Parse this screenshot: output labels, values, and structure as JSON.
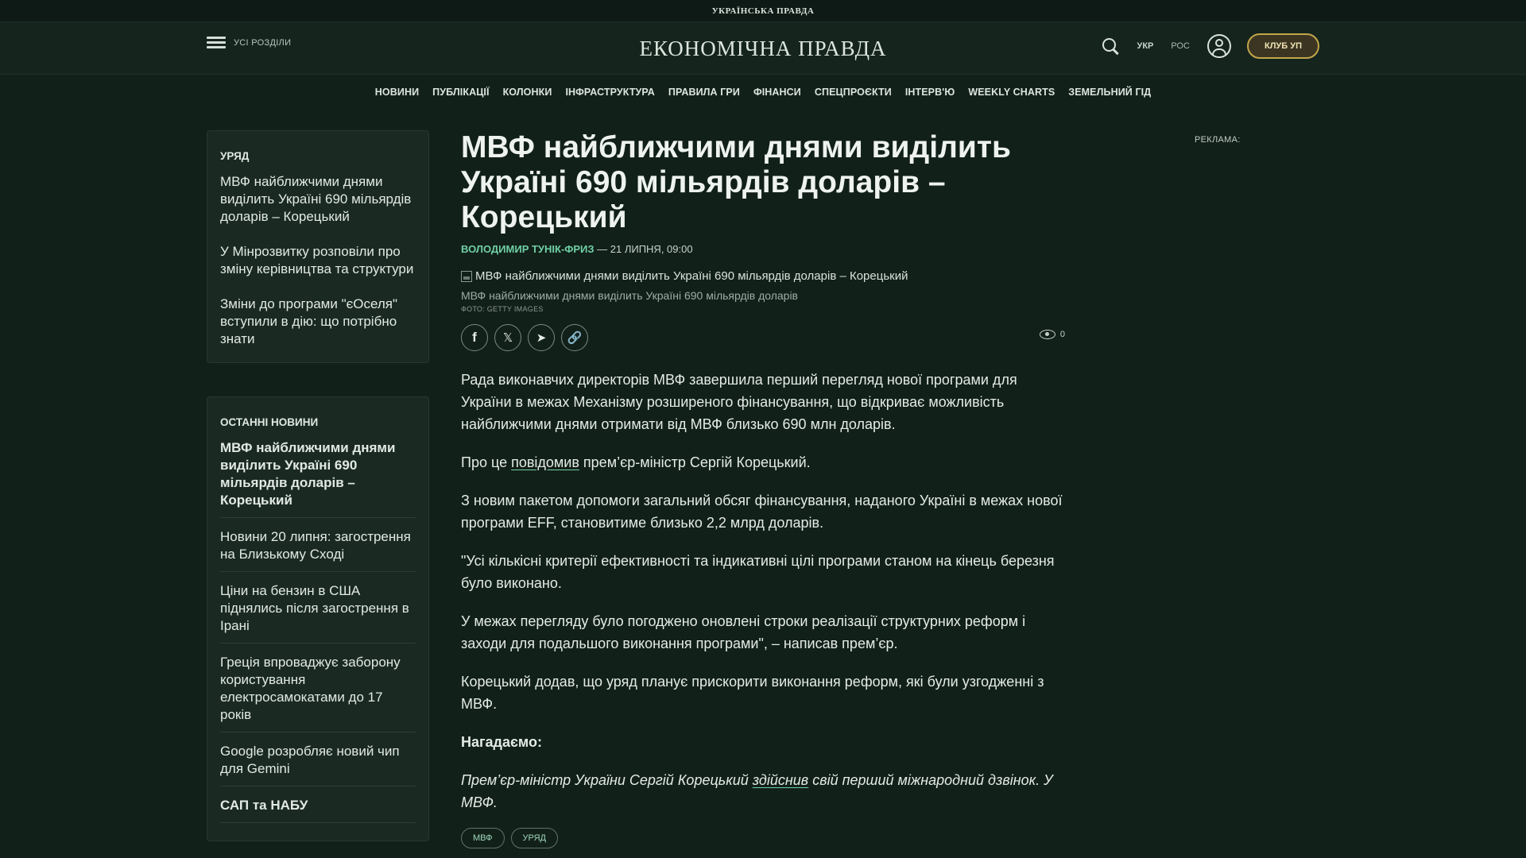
{
  "topbar": {
    "brand": "УКРАЇНСЬКА ПРАВДА"
  },
  "header": {
    "menu_label": "УСІ РОЗДІЛИ",
    "logo": "ЕКОНОМІЧНА ПРАВДА",
    "lang_ukr": "УКР",
    "lang_ros": "РОС",
    "club_button": "КЛУБ УП"
  },
  "nav": {
    "items": [
      "НОВИНИ",
      "ПУБЛІКАЦІЇ",
      "КОЛОНКИ",
      "ІНФРАСТРУКТУРА",
      "ПРАВИЛА ГРИ",
      "ФІНАНСИ",
      "СПЕЦПРОЄКТИ",
      "ІНТЕРВ'Ю",
      "WEEKLY CHARTS",
      "ЗЕМЕЛЬНИЙ ГІД"
    ]
  },
  "sidebar": {
    "section_title": "УРЯД",
    "section_items": [
      "МВФ найближчими днями виділить Україні 690 мільярдів доларів – Корецький",
      "У Мінрозвитку розповіли про зміну керівництва та структури",
      "Зміни до програми \"єОселя\" вступили в дію: що потрібно знати"
    ],
    "latest_title": "ОСТАННІ НОВИНИ",
    "latest_items": [
      "МВФ найближчими днями виділить Україні 690 мільярдів доларів – Корецький",
      "Новини 20 липня: загострення на Близькому Сході",
      "Ціни на бензин в США піднялись після загострення в Ірані",
      "Греція впроваджує заборону користування електросамокатами до 17 років",
      "Google розробляє новий чип для Gemini",
      "САП та НАБУ"
    ]
  },
  "article": {
    "title": "МВФ найближчими днями виділить Україні 690 мільярдів доларів – Корецький",
    "author": "ВОЛОДИМИР ТУНІК-ФРИЗ",
    "date": " — 21 ЛИПНЯ, 09:00",
    "image_alt": "МВФ найближчими днями виділить Україні 690 мільярдів доларів – Корецький",
    "caption": "МВФ найближчими днями виділить Україні 690 мільярдів доларів",
    "credit": "ФОТО: GETTY IMAGES",
    "views": "0",
    "p1": "Рада виконавчих директорів МВФ завершила перший перегляд нової програми для України в межах Механізму розширеного фінансування, що відкриває можливість найближчими днями отримати від МВФ близько 690 млн доларів.",
    "p2_before": "Про це ",
    "p2_link": "повідомив",
    "p2_after": " прем’єр-міністр Сергій Корецький.",
    "p3": "З новим пакетом допомоги загальний обсяг фінансування, наданого Україні в межах нової програми EFF, становитиме близько 2,2 млрд доларів.",
    "p4": "\"Усі кількісні критерії ефективності та індикативні цілі програми станом на кінець березня було виконано.",
    "p5": "У межах перегляду було погоджено оновлені строки реалізації структурних реформ і заходи для подальшого виконання програми\", – написав прем’єр.",
    "p6": "Корецький додав, що уряд планує прискорити виконання реформ, які були узгодженні з МВФ.",
    "reminder": "Нагадаємо:",
    "p7_before": "Прем’єр-міністр України Сергій Корецький ",
    "p7_link": "здійснив",
    "p7_after": " свій перший міжнародний дзвінок. У МВФ.",
    "tags": [
      "МВФ",
      "УРЯД"
    ]
  },
  "ad": {
    "label": "РЕКЛАМА:"
  },
  "colors": {
    "background": "#12201a",
    "accent": "#6fd0a4",
    "club_border": "#c2a64a"
  }
}
